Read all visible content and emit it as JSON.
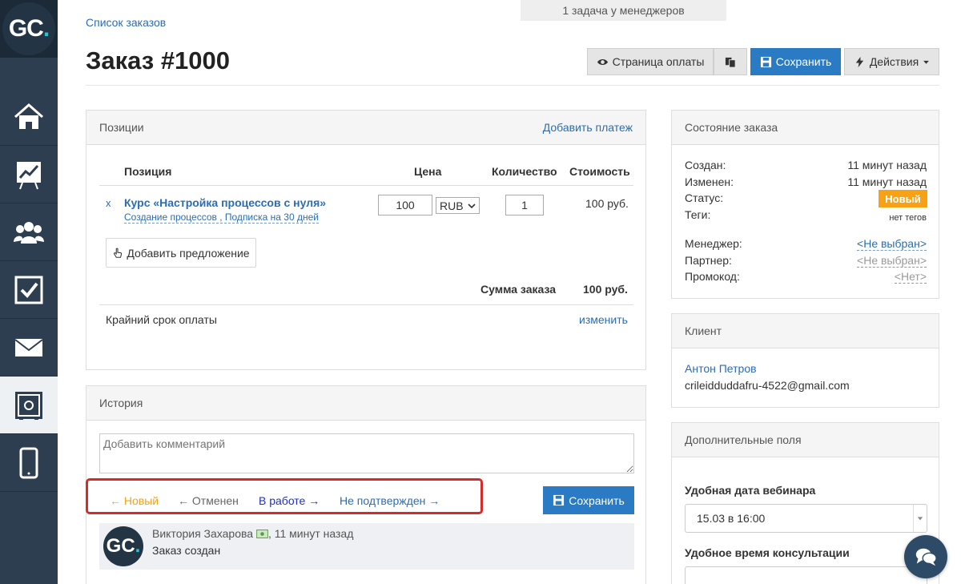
{
  "app": {
    "logo_text": "GC",
    "logo_dot": "."
  },
  "sidebar": {
    "items": [
      {
        "name": "home-icon"
      },
      {
        "name": "chart-icon"
      },
      {
        "name": "users-icon"
      },
      {
        "name": "checkbox-icon"
      },
      {
        "name": "mail-icon"
      },
      {
        "name": "safe-icon",
        "active": true
      },
      {
        "name": "phone-icon"
      }
    ]
  },
  "header": {
    "breadcrumb": "Список заказов",
    "tasks_banner": "1 задача у менеджеров",
    "title": "Заказ #1000",
    "buttons": {
      "payment_page": "Страница оплаты",
      "save": "Сохранить",
      "actions": "Действия"
    }
  },
  "positions": {
    "title": "Позиции",
    "add_payment": "Добавить платеж",
    "columns": {
      "position": "Позиция",
      "price": "Цена",
      "quantity": "Количество",
      "cost": "Стоимость"
    },
    "item": {
      "remove": "x",
      "name": "Курс «Настройка процессов с нуля»",
      "sub": "Создание процессов , Подписка на 30 дней",
      "price": "100",
      "currency": "RUB",
      "quantity": "1",
      "cost": "100 руб."
    },
    "add_offer": "Добавить предложение",
    "total_label": "Сумма заказа",
    "total_value": "100 руб.",
    "deadline_label": "Крайний срок оплаты",
    "deadline_change": "изменить"
  },
  "history": {
    "title": "История",
    "comment_placeholder": "Добавить комментарий",
    "statuses": {
      "new": "← Новый",
      "cancelled": "← Отменен",
      "in_work": "В работе →",
      "unconfirmed": "Не подтвержден →"
    },
    "save": "Сохранить",
    "entry": {
      "author": "Виктория Захарова",
      "time": ", 11 минут назад",
      "text": "Заказ создан"
    }
  },
  "order_state": {
    "title": "Состояние заказа",
    "created_label": "Создан:",
    "created_value": "11 минут назад",
    "modified_label": "Изменен:",
    "modified_value": "11 минут назад",
    "status_label": "Статус:",
    "status_value": "Новый",
    "tags_label": "Теги:",
    "tags_value": "нет тегов",
    "manager_label": "Менеджер:",
    "manager_value": "<Не выбран>",
    "partner_label": "Партнер:",
    "partner_value": "<Не выбран>",
    "promo_label": "Промокод:",
    "promo_value": "<Нет>"
  },
  "client": {
    "title": "Клиент",
    "name": "Антон Петров",
    "email": "crileidduddafru-4522@gmail.com"
  },
  "extra_fields": {
    "title": "Дополнительные поля",
    "webinar_label": "Удобная дата вебинара",
    "webinar_value": "15.03 в 16:00",
    "consult_label": "Удобное время консультации"
  },
  "colors": {
    "accent": "#2a7bc4",
    "status_new": "#f9a114",
    "sidebar": "#2d3e50",
    "highlight": "#d62b2b"
  }
}
